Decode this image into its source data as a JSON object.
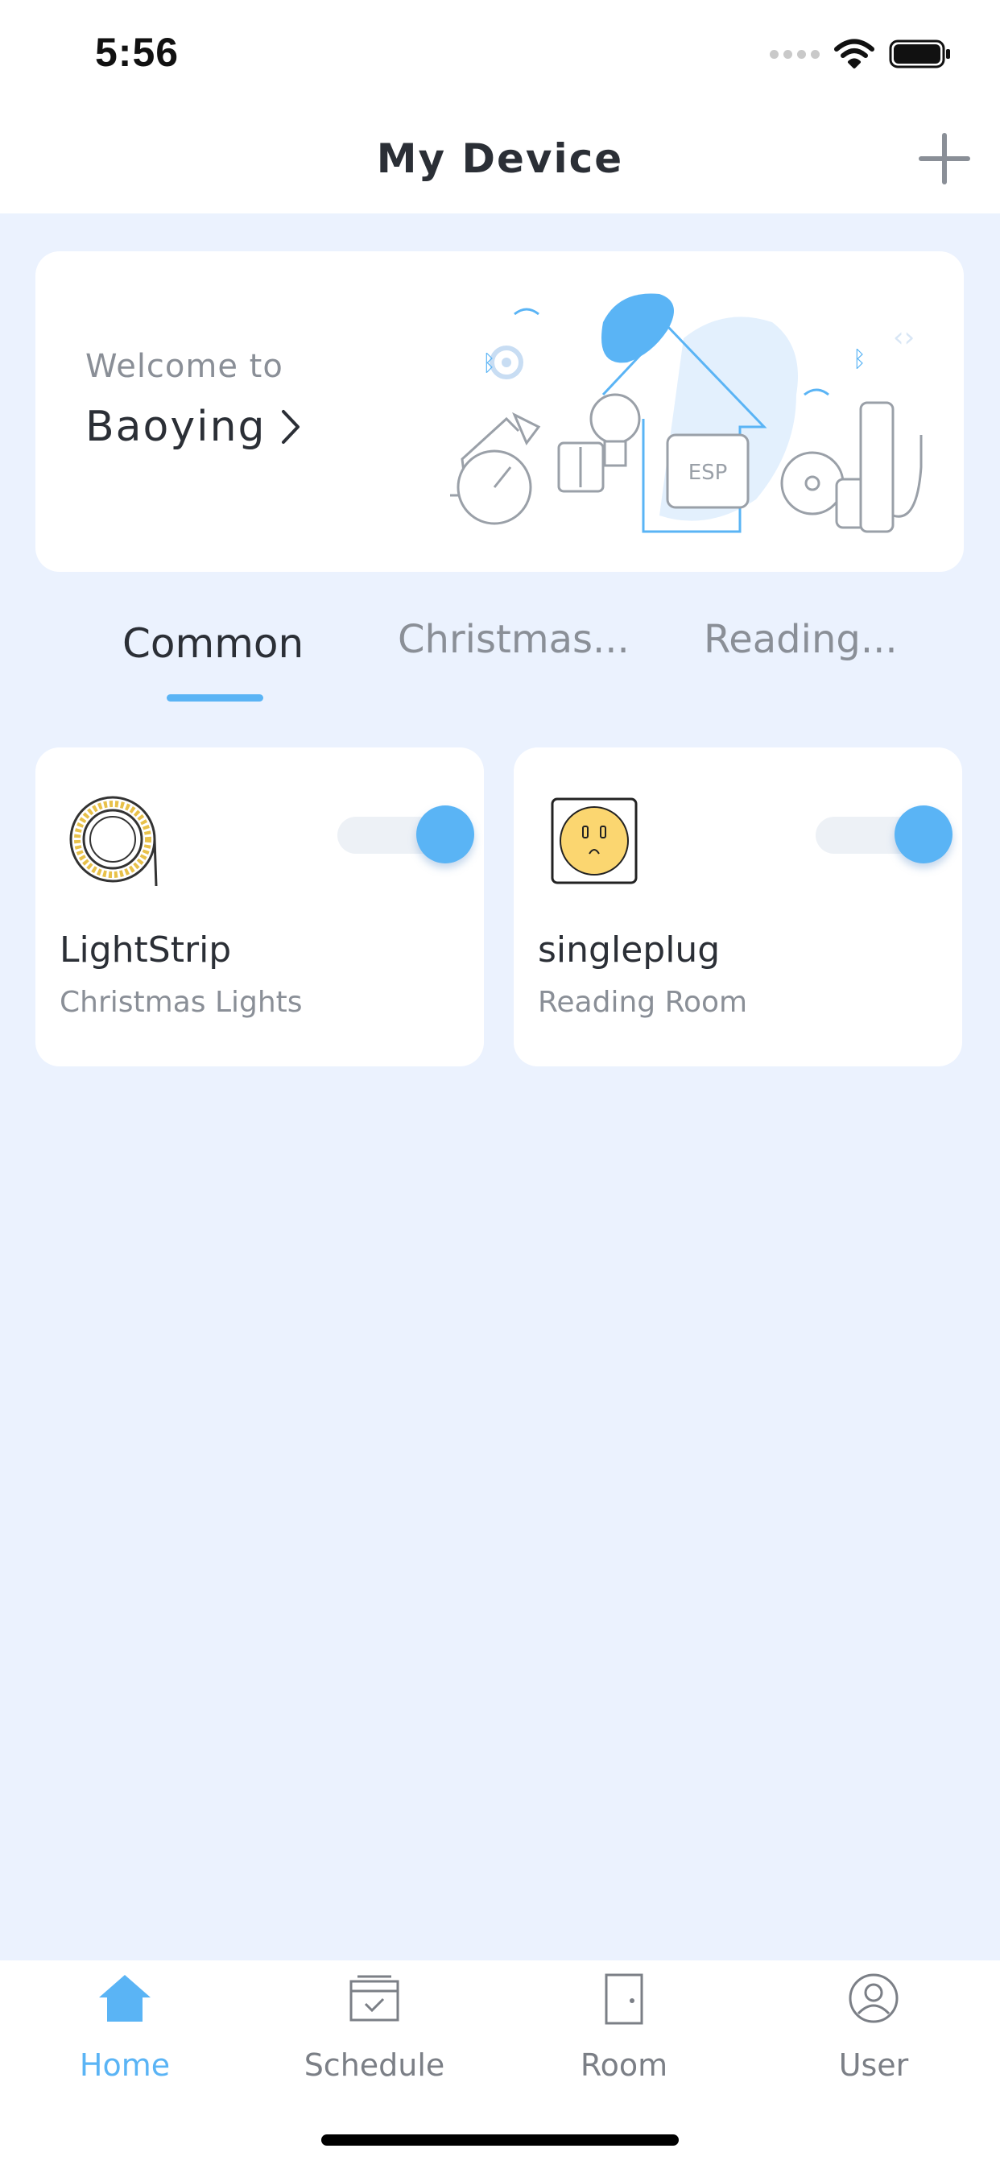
{
  "status_bar": {
    "time": "5:56"
  },
  "header": {
    "title": "My Device",
    "add_icon": "plus-icon"
  },
  "welcome": {
    "greeting": "Welcome to",
    "home_name": "Baoying"
  },
  "tabs": [
    {
      "label": "Common",
      "active": true
    },
    {
      "label": "Christmas..."
    },
    {
      "label": "Reading..."
    }
  ],
  "devices": [
    {
      "name": "LightStrip",
      "room": "Christmas Lights",
      "icon": "light-strip-icon",
      "on": true
    },
    {
      "name": "singleplug",
      "room": "Reading Room",
      "icon": "smart-plug-icon",
      "on": true
    }
  ],
  "tab_bar": [
    {
      "label": "Home",
      "icon": "home-icon",
      "selected": true
    },
    {
      "label": "Schedule",
      "icon": "calendar-icon"
    },
    {
      "label": "Room",
      "icon": "door-icon"
    },
    {
      "label": "User",
      "icon": "user-icon"
    }
  ],
  "colors": {
    "accent": "#5ab4f5",
    "background": "#ebf2fe",
    "text": "#2b2f36",
    "muted": "#8a8f97"
  }
}
